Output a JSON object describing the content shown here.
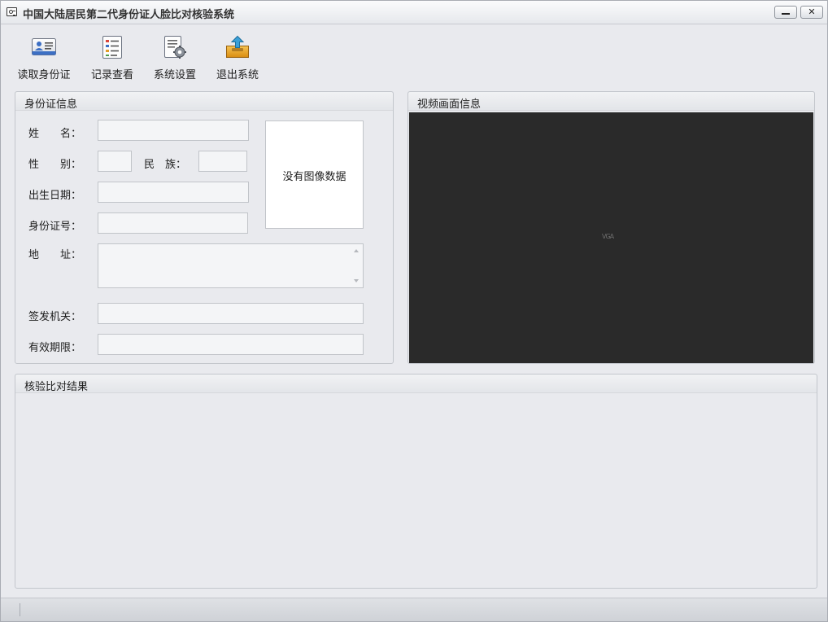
{
  "window": {
    "title": "中国大陆居民第二代身份证人脸比对核验系统",
    "minimize_glyph": "",
    "close_glyph": "✕"
  },
  "toolbar": {
    "items": [
      {
        "label": "读取身份证",
        "icon": "id-card-icon"
      },
      {
        "label": "记录查看",
        "icon": "record-list-icon"
      },
      {
        "label": "系统设置",
        "icon": "settings-gear-icon"
      },
      {
        "label": "退出系统",
        "icon": "exit-upload-icon"
      }
    ]
  },
  "id_info": {
    "title": "身份证信息",
    "name_label": "姓　　名：",
    "gender_label": "性　　别：",
    "ethnicity_label": "民　族：",
    "birth_label": "出生日期：",
    "id_number_label": "身份证号：",
    "address_label": "地　　址：",
    "authority_label": "签发机关：",
    "validity_label": "有效期限：",
    "name_value": "",
    "gender_value": "",
    "ethnicity_value": "",
    "birth_value": "",
    "id_number_value": "",
    "address_value": "",
    "authority_value": "",
    "validity_value": "",
    "photo_placeholder": "没有图像数据"
  },
  "video": {
    "title": "视频画面信息",
    "placeholder": "VGA"
  },
  "result": {
    "title": "核验比对结果"
  },
  "colors": {
    "background": "#e9eaee",
    "video_background": "#2a2a2a",
    "field_background": "#f4f5f7"
  }
}
